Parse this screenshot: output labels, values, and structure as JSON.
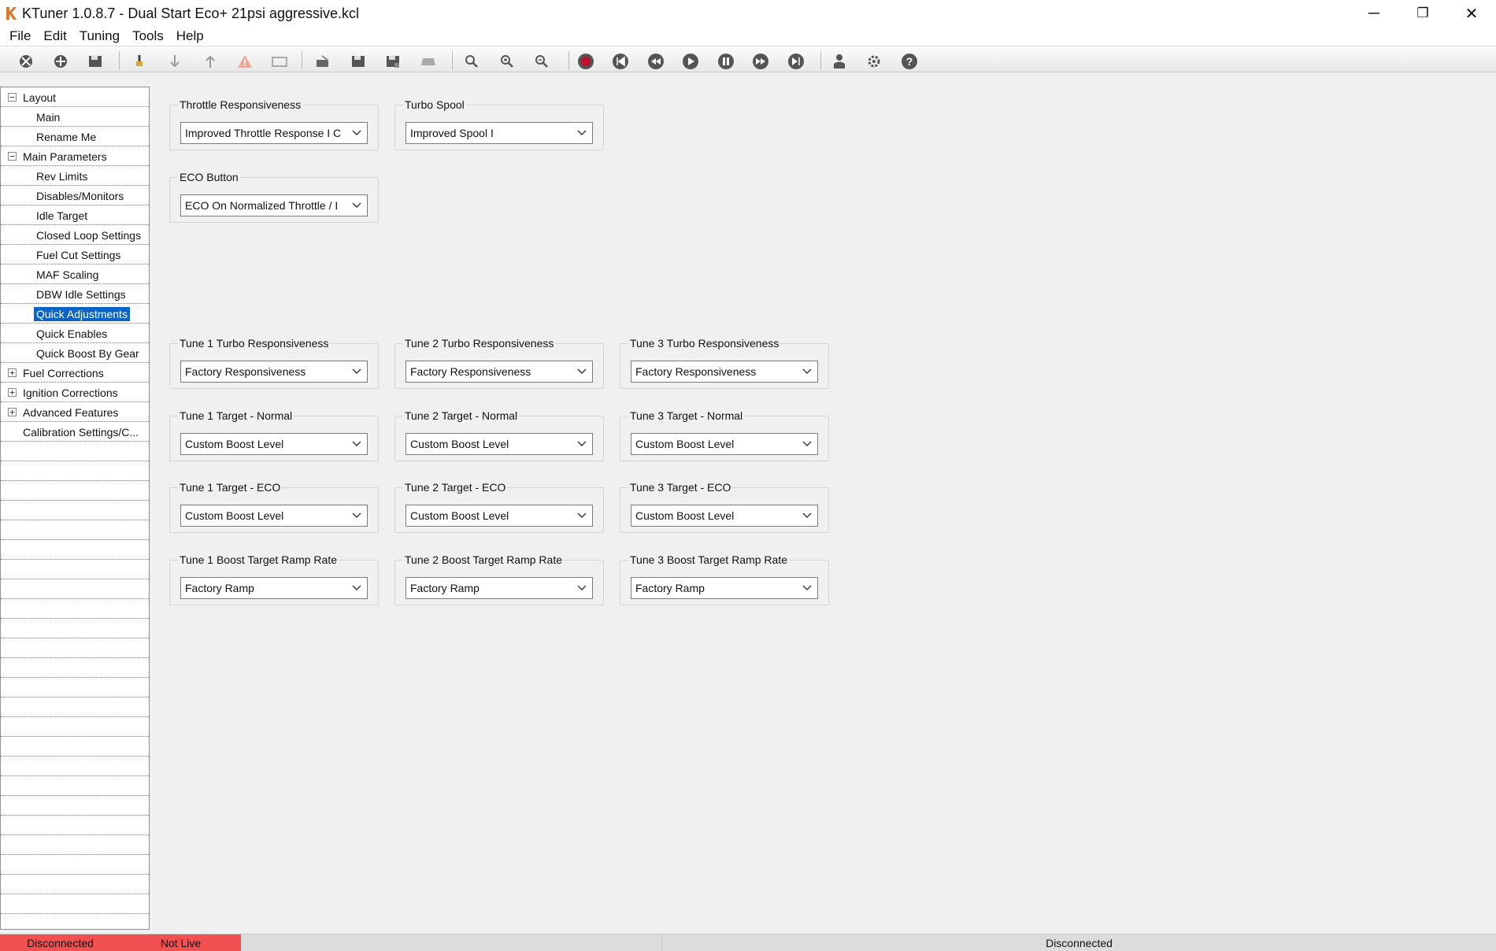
{
  "window": {
    "title": "KTuner 1.0.8.7 - Dual Start Eco+ 21psi aggressive.kcl",
    "icon": "ktuner-logo-icon",
    "minimize_symbol": "─",
    "maximize_symbol": "❐",
    "close_symbol": "✕"
  },
  "menu": [
    "File",
    "Edit",
    "Tuning",
    "Tools",
    "Help"
  ],
  "toolbar_icons": [
    "disconnect-icon",
    "connect-icon",
    "save-icon",
    "upload-icon",
    "download-icon",
    "flash-icon",
    "warning-icon",
    "monitor-icon",
    "compare-icon",
    "save-file-icon",
    "save-as-icon",
    "device-icon",
    "zoom-icon",
    "zoom-in-icon",
    "zoom-out-icon",
    "record-icon",
    "skip-back-icon",
    "rewind-icon",
    "play-icon",
    "pause-icon",
    "fast-forward-icon",
    "skip-forward-icon",
    "user-icon",
    "settings-icon",
    "help-icon"
  ],
  "tree": [
    {
      "label": "Layout",
      "level": 0,
      "expander": "−"
    },
    {
      "label": "Main",
      "level": 1
    },
    {
      "label": "Rename Me",
      "level": 1
    },
    {
      "label": "Main Parameters",
      "level": 0,
      "expander": "−"
    },
    {
      "label": "Rev Limits",
      "level": 1
    },
    {
      "label": "Disables/Monitors",
      "level": 1
    },
    {
      "label": "Idle Target",
      "level": 1
    },
    {
      "label": "Closed Loop Settings",
      "level": 1
    },
    {
      "label": "Fuel Cut Settings",
      "level": 1
    },
    {
      "label": "MAF Scaling",
      "level": 1
    },
    {
      "label": "DBW Idle Settings",
      "level": 1
    },
    {
      "label": "Quick Adjustments",
      "level": 1,
      "selected": true
    },
    {
      "label": "Quick Enables",
      "level": 1
    },
    {
      "label": "Quick Boost By Gear",
      "level": 1
    },
    {
      "label": "Fuel Corrections",
      "level": 0,
      "expander": "+"
    },
    {
      "label": "Ignition Corrections",
      "level": 0,
      "expander": "+"
    },
    {
      "label": "Advanced Features",
      "level": 0,
      "expander": "+"
    },
    {
      "label": "Calibration Settings/C...",
      "level": 0
    }
  ],
  "groups": [
    {
      "label": "Throttle Responsiveness",
      "value": "Improved Throttle Response I C"
    },
    {
      "label": "Turbo Spool",
      "value": "Improved Spool I"
    },
    {
      "label": "ECO Button",
      "value": "ECO On Normalized Throttle / I"
    },
    {
      "label": "Tune 1 Turbo Responsiveness",
      "value": "Factory Responsiveness"
    },
    {
      "label": "Tune 2 Turbo Responsiveness",
      "value": "Factory Responsiveness"
    },
    {
      "label": "Tune 3 Turbo Responsiveness",
      "value": "Factory Responsiveness"
    },
    {
      "label": "Tune 1 Target - Normal",
      "value": "Custom Boost Level"
    },
    {
      "label": "Tune 2 Target - Normal",
      "value": "Custom Boost Level"
    },
    {
      "label": "Tune 3 Target - Normal",
      "value": "Custom Boost Level"
    },
    {
      "label": "Tune 1 Target - ECO",
      "value": "Custom Boost Level"
    },
    {
      "label": "Tune 2 Target - ECO",
      "value": "Custom Boost Level"
    },
    {
      "label": "Tune 3 Target - ECO",
      "value": "Custom Boost Level"
    },
    {
      "label": "Tune 1 Boost Target Ramp Rate",
      "value": "Factory Ramp"
    },
    {
      "label": "Tune 2 Boost Target Ramp Rate",
      "value": "Factory Ramp"
    },
    {
      "label": "Tune 3 Boost Target Ramp Rate",
      "value": "Factory Ramp"
    }
  ],
  "status": {
    "connection": "Disconnected",
    "live": "Not Live",
    "right": "Disconnected",
    "alert_color": "#f05050"
  },
  "colors": {
    "selection": "#0a64c8",
    "record_red": "#c0102a"
  }
}
